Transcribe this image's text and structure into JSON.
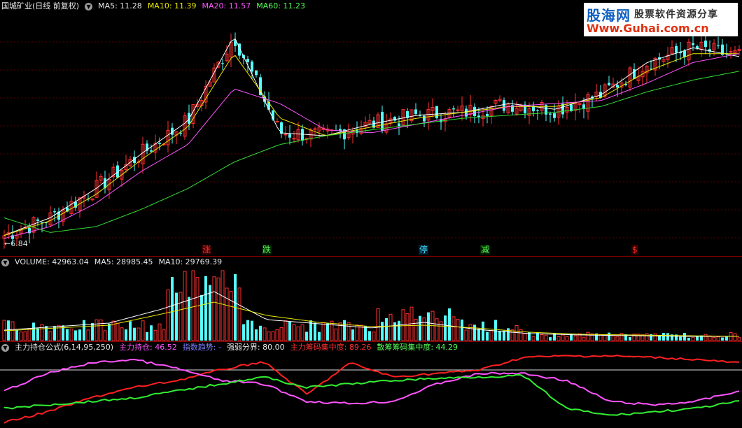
{
  "price_panel": {
    "title": "国城矿业(日线 前复权)",
    "ma5": "MA5: 11.28",
    "ma10": "MA10: 11.39",
    "ma20": "MA20: 11.57",
    "ma60": "MA60: 11.23",
    "low_label": "←6.84",
    "signals": [
      {
        "text": "涨",
        "class": "sig-red"
      },
      {
        "text": "跌",
        "class": "sig-green"
      },
      {
        "text": "停",
        "class": "sig-cyan"
      },
      {
        "text": "减",
        "class": "sig-green"
      },
      {
        "text": "$",
        "class": "sig-red"
      }
    ]
  },
  "volume_panel": {
    "title": "VOLUME: 42963.04",
    "ma5": "MA5: 28985.45",
    "ma10": "MA10: 29769.39"
  },
  "indicator_panel": {
    "title": "主力持仓公式(6,14,95,250)",
    "l1": "主力持仓: 46.52",
    "l2": "指数趋势: -",
    "l3": "强弱分界: 80.00",
    "l4": "主力筹码集中度: 89.26",
    "l5": "散筹筹码集中度: 44.29"
  },
  "watermark": {
    "brand": "股海网",
    "slogan": "股票软件资源分享",
    "url": "Www.Guhai.com.cn"
  },
  "colors": {
    "up": "#ff3030",
    "down": "#54ffff",
    "ma5": "#ffffff",
    "ma10": "#e8e800",
    "ma20": "#ff55ff",
    "ma60": "#33dd33"
  },
  "chart_data": {
    "type": "line",
    "series": [
      {
        "name": "MA5",
        "values": [
          7.0,
          7.6,
          8.6,
          9.8,
          10.9,
          13.8,
          10.5,
          10.4,
          10.8,
          11.1,
          11.2,
          11.5,
          11.3,
          11.8,
          12.9,
          13.4,
          13.1
        ]
      },
      {
        "name": "MA10",
        "values": [
          7.0,
          7.5,
          8.4,
          9.6,
          10.7,
          13.2,
          11.0,
          10.4,
          10.7,
          11.0,
          11.2,
          11.4,
          11.4,
          11.7,
          12.6,
          13.2,
          13.2
        ]
      },
      {
        "name": "MA20",
        "values": [
          6.9,
          7.3,
          8.1,
          9.2,
          10.1,
          12.0,
          11.5,
          10.6,
          10.5,
          10.8,
          11.1,
          11.4,
          11.5,
          11.6,
          12.2,
          12.9,
          13.2
        ]
      },
      {
        "name": "MA60",
        "values": [
          7.6,
          7.1,
          7.3,
          7.9,
          8.6,
          9.5,
          10.1,
          10.4,
          10.6,
          10.8,
          11.0,
          11.1,
          11.2,
          11.4,
          11.9,
          12.3,
          12.6
        ]
      }
    ],
    "ylim": [
      6.8,
      14.6
    ]
  }
}
